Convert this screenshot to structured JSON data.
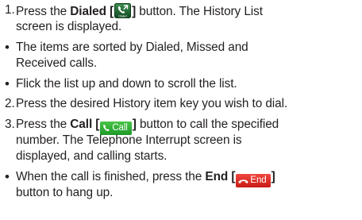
{
  "steps": [
    {
      "number": "1.",
      "pre": "Press the ",
      "bold": "Dialed",
      "bracket_open": " [",
      "bracket_close": "]",
      "post": " button. The History List",
      "continuation": "screen is displayed.",
      "icon": "dialed-history-icon",
      "icon_label": "Dialed"
    },
    {
      "number": "2.",
      "text": "Press the desired History item key you wish to dial."
    },
    {
      "number": "3.",
      "pre": "Press the ",
      "bold": "Call",
      "bracket_open": " [",
      "bracket_close": "]",
      "post": " button to call the specified",
      "continuation_1": "number. The Telephone Interrupt screen is",
      "continuation_2": "displayed, and calling starts.",
      "button_label": "Call",
      "icon": "phone-handset-icon"
    }
  ],
  "bullets": [
    {
      "symbol": "•",
      "text_1": "The items are sorted by Dialed, Missed and",
      "text_2": "Received calls."
    },
    {
      "symbol": "•",
      "text": "Flick the list up and down to scroll the list."
    },
    {
      "symbol": "•",
      "pre": "When the call is finished, press the ",
      "bold": "End",
      "bracket_open": " [",
      "bracket_close": "]",
      "continuation": "button to hang up.",
      "button_label": "End",
      "icon": "hang-up-icon"
    }
  ],
  "colors": {
    "text": "#231f20",
    "call_button": "#2aa836",
    "end_button": "#e02a22",
    "dialed_icon_bg": "#1f6b34"
  }
}
